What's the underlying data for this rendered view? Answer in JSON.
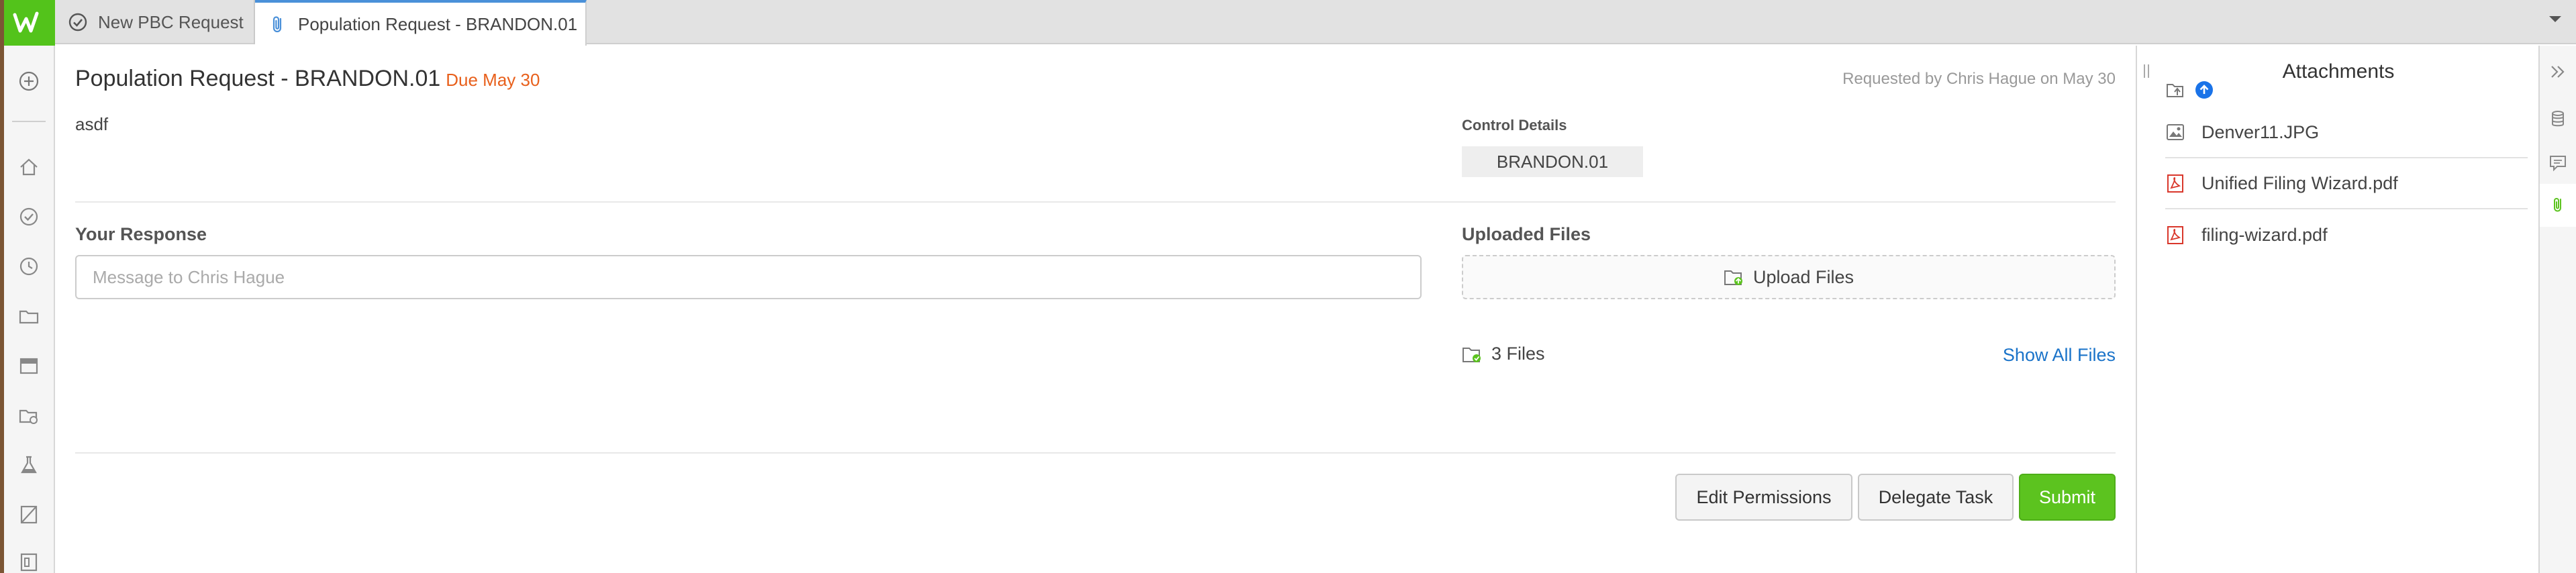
{
  "colors": {
    "brand": "#53c31b",
    "accent": "#4a90d9",
    "due": "#e8601c",
    "link": "#1a73c9",
    "submit": "#5cc31f"
  },
  "tabs": [
    {
      "label": "New PBC Request",
      "icon": "check-circle-icon",
      "active": false
    },
    {
      "label": "Population Request - BRANDON.01",
      "icon": "paperclip-icon",
      "active": true
    }
  ],
  "nav": {
    "items": [
      "add-icon",
      "home-icon",
      "tasks-icon",
      "history-icon",
      "folder-icon",
      "archive-icon",
      "folder-settings-icon",
      "lab-icon",
      "book-icon",
      "reports-icon"
    ]
  },
  "request": {
    "title": "Population Request - BRANDON.01",
    "due": "Due May 30",
    "requested_by": "Requested by Chris Hague on May 30",
    "description": "asdf"
  },
  "control": {
    "label": "Control Details",
    "chip": "BRANDON.01"
  },
  "response": {
    "label": "Your Response",
    "placeholder": "Message to Chris Hague",
    "value": ""
  },
  "uploads": {
    "label": "Uploaded Files",
    "button": "Upload Files",
    "count": "3 Files",
    "show_all": "Show All Files"
  },
  "actions": {
    "edit": "Edit Permissions",
    "delegate": "Delegate Task",
    "submit": "Submit"
  },
  "attachments": {
    "title": "Attachments",
    "items": [
      {
        "name": "Denver11.JPG",
        "icon": "image-file-icon"
      },
      {
        "name": "Unified Filing Wizard.pdf",
        "icon": "pdf-file-icon"
      },
      {
        "name": "filing-wizard.pdf",
        "icon": "pdf-file-icon"
      }
    ]
  },
  "right_rail": [
    "collapse-icon",
    "database-icon",
    "comments-icon",
    "attachments-icon"
  ]
}
